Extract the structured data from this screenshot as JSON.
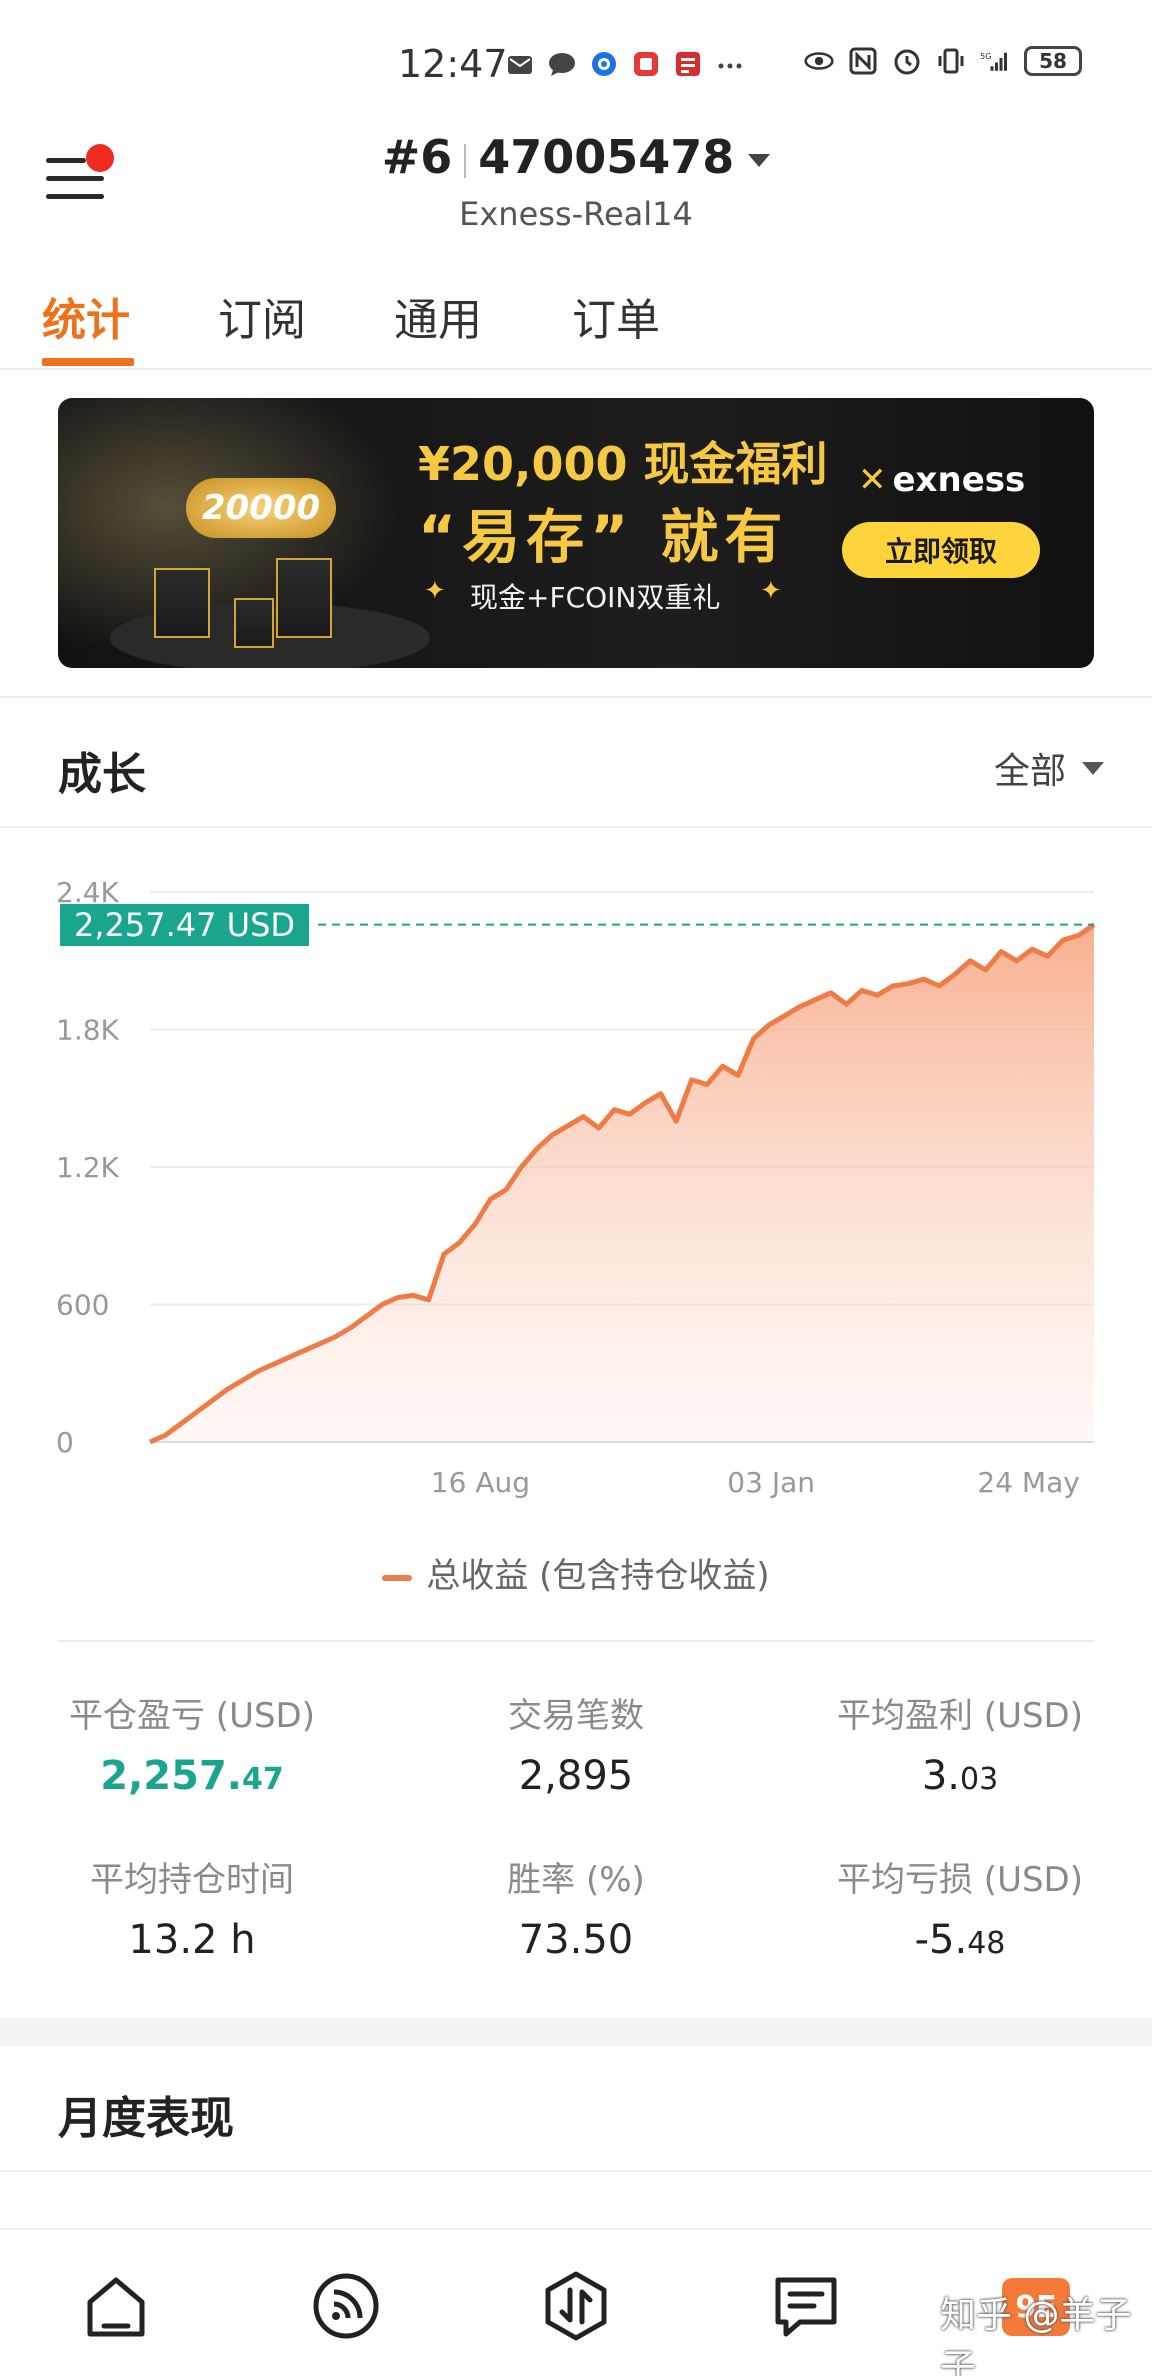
{
  "status_bar": {
    "time": "12:47",
    "battery": "58",
    "signal": "5G",
    "icons_left": [
      "mail-icon",
      "chat-icon",
      "browser-icon",
      "app-icon",
      "news-icon",
      "more-icon"
    ],
    "icons_right": [
      "eye-icon",
      "nfc-icon",
      "alarm-icon",
      "vibrate-icon",
      "signal-icon",
      "battery-icon"
    ]
  },
  "header": {
    "account_prefix": "#6",
    "account_number": "47005478",
    "server": "Exness-Real14"
  },
  "tabs": [
    {
      "label": "统计",
      "active": true
    },
    {
      "label": "订阅",
      "active": false
    },
    {
      "label": "通用",
      "active": false
    },
    {
      "label": "订单",
      "active": false
    }
  ],
  "banner": {
    "line1": "¥20,000 现金福利",
    "line2": "“易存” 就有",
    "line3": "现金+FCOIN双重礼",
    "coins_text": "20000",
    "brand": "exness",
    "cta": "立即领取"
  },
  "growth": {
    "title": "成长",
    "filter": "全部",
    "current_value_label": "2,257.47 USD",
    "legend": "总收益 (包含持仓收益)"
  },
  "chart_data": {
    "type": "area",
    "ylabel": "",
    "xlabel": "",
    "ylim": [
      0,
      2400
    ],
    "yticks": [
      "0",
      "600",
      "1.2K",
      "1.8K",
      "2.4K"
    ],
    "xticks": [
      "16 Aug",
      "03 Jan",
      "24 May"
    ],
    "current_value": 2257.47,
    "series": [
      {
        "name": "总收益 (包含持仓收益)",
        "color": "#ef7b47",
        "values": [
          0,
          30,
          80,
          130,
          180,
          230,
          270,
          310,
          340,
          370,
          400,
          430,
          460,
          500,
          550,
          600,
          630,
          640,
          620,
          820,
          870,
          950,
          1060,
          1100,
          1200,
          1280,
          1340,
          1380,
          1420,
          1370,
          1450,
          1430,
          1480,
          1520,
          1400,
          1580,
          1560,
          1640,
          1600,
          1760,
          1820,
          1860,
          1900,
          1930,
          1960,
          1910,
          1970,
          1950,
          1990,
          2000,
          2020,
          1990,
          2040,
          2100,
          2060,
          2140,
          2100,
          2150,
          2120,
          2190,
          2210,
          2257.47
        ]
      }
    ]
  },
  "stats": [
    {
      "label": "平仓盈亏 (USD)",
      "value_main": "2,257.",
      "value_small": "47",
      "green": true
    },
    {
      "label": "交易笔数",
      "value_main": "2,895",
      "value_small": "",
      "green": false
    },
    {
      "label": "平均盈利 (USD)",
      "value_main": "3.",
      "value_small": "03",
      "green": false
    },
    {
      "label": "平均持仓时间",
      "value_main": "13.2 h",
      "value_small": "",
      "green": false
    },
    {
      "label": "胜率 (%)",
      "value_main": "73.50",
      "value_small": "",
      "green": false
    },
    {
      "label": "平均亏损 (USD)",
      "value_main": "-5.",
      "value_small": "48",
      "green": false
    }
  ],
  "monthly": {
    "title": "月度表现"
  },
  "bottom_nav": {
    "items": [
      "home-icon",
      "signal-feed-icon",
      "trade-icon",
      "news-icon",
      "profile-icon"
    ],
    "badge": "9E"
  },
  "watermark": "知乎 @羊子子"
}
